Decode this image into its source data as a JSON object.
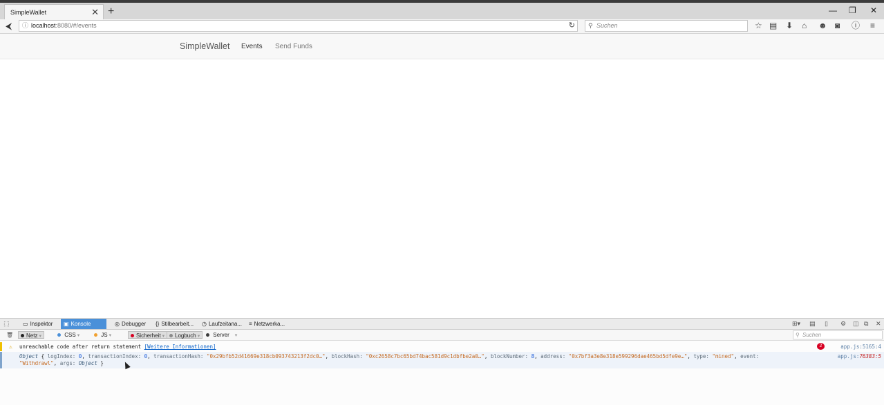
{
  "browser": {
    "tab_title": "SimpleWallet",
    "tab_close": "✕",
    "new_tab": "+",
    "window_controls": [
      "—",
      "❐",
      "✕"
    ],
    "url_host": "localhost",
    "url_rest": ":8080/#/events",
    "search_placeholder": "Suchen"
  },
  "page": {
    "brand": "SimpleWallet",
    "nav": [
      "Events",
      "Send Funds"
    ],
    "active_nav": "Events"
  },
  "devtools": {
    "tabs": [
      "Inspektor",
      "Konsole",
      "Debugger",
      "Stilbearbeit...",
      "Laufzeitana...",
      "Netzwerka..."
    ],
    "active_tab": "Konsole",
    "filters": [
      {
        "label": "Netz",
        "color": "#222222"
      },
      {
        "label": "CSS",
        "color": "#4a90d9"
      },
      {
        "label": "JS",
        "color": "#f0a030"
      },
      {
        "label": "Sicherheit",
        "color": "#d70022"
      },
      {
        "label": "Logbuch",
        "color": "#8a8a8a"
      },
      {
        "label": "Server",
        "color": "#3b3b3b"
      }
    ],
    "filter_search_placeholder": "Suchen",
    "messages": {
      "warning_text": "unreachable code after return statement",
      "warning_link": "[Weitere Informationen]",
      "warning_count": "2",
      "warning_location": "app.js:5165:4",
      "log_line1": {
        "prefix": "Object",
        "brace_open": "{",
        "logIndex_key": "logIndex:",
        "logIndex_val": "0",
        "transactionIndex_key": "transactionIndex:",
        "transactionIndex_val": "0",
        "transactionHash_key": "transactionHash:",
        "transactionHash_val": "\"0x29bfb52d41669e318cb093743213f2dc0…\"",
        "blockHash_key": "blockHash:",
        "blockHash_val": "\"0xc2658c7bc65bd74bac581d9c1dbfbe2a0…\"",
        "blockNumber_key": "blockNumber:",
        "blockNumber_val": "8",
        "address_key": "address:",
        "address_val": "\"0x7bf3a3e8e318e599296dae465bd5dfe9e…\"",
        "type_key": "type:",
        "type_val": "\"mined\"",
        "event_key": "event:"
      },
      "log_line2": {
        "event_val": "\"Withdrawl\"",
        "args_key": "args:",
        "args_val": "Object",
        "brace_close": "}"
      },
      "log_location_file": "app.js:",
      "log_location_pos": "76383:5"
    }
  },
  "colors": {
    "active_tab_bg": "#4a90d9",
    "warning_border": "#f0c000",
    "error_badge": "#d70022"
  }
}
